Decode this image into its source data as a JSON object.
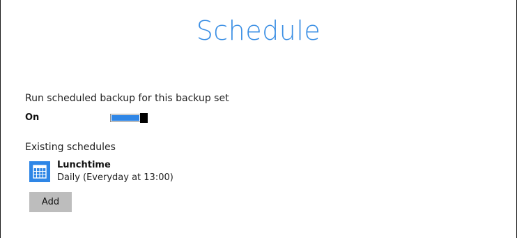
{
  "page": {
    "title": "Schedule"
  },
  "run_scheduled": {
    "label": "Run scheduled backup for this backup set",
    "state_label": "On",
    "enabled": true
  },
  "existing": {
    "label": "Existing schedules",
    "schedules": [
      {
        "name": "Lunchtime",
        "description": "Daily (Everyday at 13:00)",
        "icon": "calendar-icon"
      }
    ]
  },
  "actions": {
    "add_label": "Add"
  },
  "colors": {
    "accent": "#3b8fe4",
    "toggle_fill": "#2f86e6",
    "button_bg": "#bdbdbd"
  }
}
